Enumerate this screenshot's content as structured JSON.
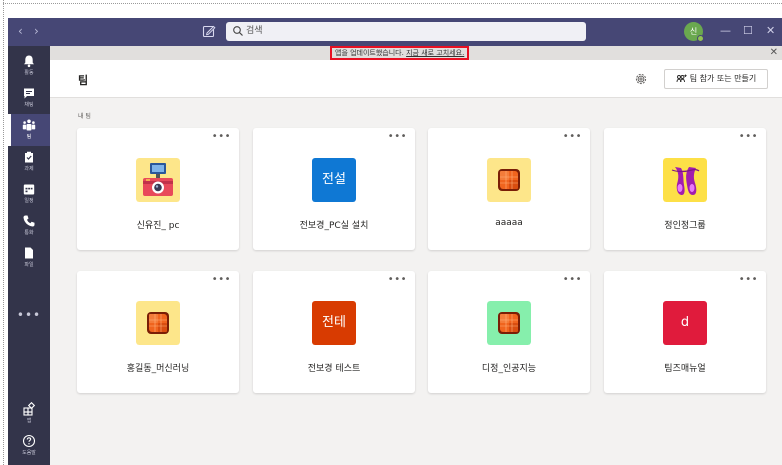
{
  "titlebar": {
    "search_placeholder": "검색",
    "avatar_initials": "신"
  },
  "banner": {
    "message": "앱을 업데이트했습니다.",
    "link": "지금 새로 고치세요."
  },
  "rail": {
    "items": [
      {
        "label": "활동",
        "icon": "bell-icon"
      },
      {
        "label": "채팅",
        "icon": "chat-icon"
      },
      {
        "label": "팀",
        "icon": "teams-icon",
        "active": true
      },
      {
        "label": "과제",
        "icon": "assignments-icon"
      },
      {
        "label": "일정",
        "icon": "calendar-icon"
      },
      {
        "label": "통화",
        "icon": "phone-icon"
      },
      {
        "label": "파일",
        "icon": "file-icon"
      }
    ],
    "apps_label": "앱",
    "help_label": "도움말"
  },
  "header": {
    "title": "팀",
    "join_button": "팀 참가 또는 만들기"
  },
  "content": {
    "section_label": "내 팀",
    "teams": [
      {
        "name": "신유진_ pc",
        "avatar": "camera-image",
        "avatar_text": ""
      },
      {
        "name": "전보경_PC실 설치",
        "avatar": "text",
        "avatar_text": "전설",
        "color": "#0f78d4"
      },
      {
        "name": "aaaaa",
        "avatar": "orange-square",
        "avatar_text": ""
      },
      {
        "name": "정인정그룹",
        "avatar": "ballet-shoes-image",
        "avatar_text": ""
      },
      {
        "name": "홍길동_머신러닝",
        "avatar": "orange-square",
        "avatar_text": ""
      },
      {
        "name": "전보경 테스트",
        "avatar": "text",
        "avatar_text": "전테",
        "color": "#d83b01"
      },
      {
        "name": "디정_인공지능",
        "avatar": "orange-square-green",
        "avatar_text": ""
      },
      {
        "name": "팀즈매뉴얼",
        "avatar": "text",
        "avatar_text": "d",
        "color": "#e01b3c"
      }
    ]
  },
  "colors": {
    "titlebar": "#464775",
    "rail": "#33344a",
    "highlight_border": "#e81123"
  }
}
